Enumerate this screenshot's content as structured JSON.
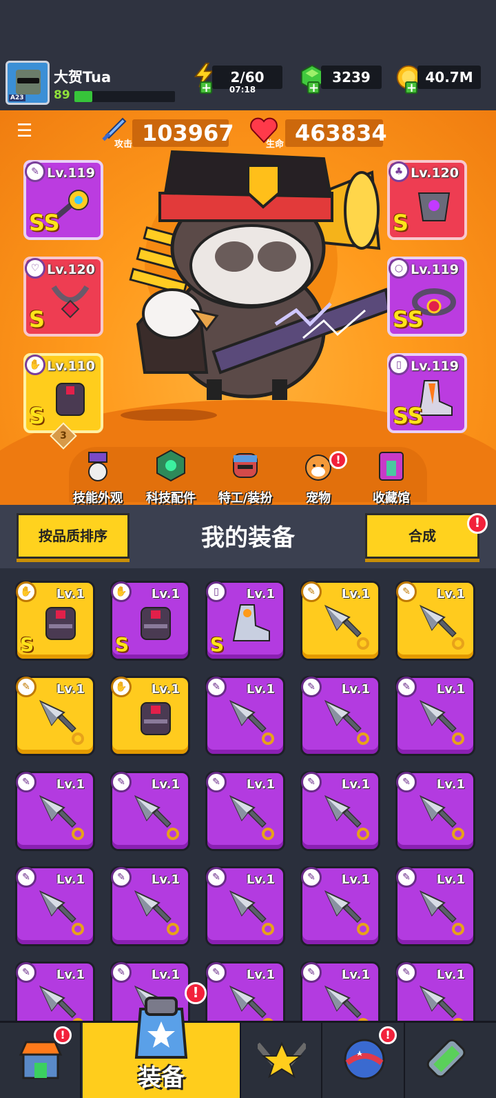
{
  "player": {
    "name": "大贺Tua",
    "level": "89",
    "xp_fraction": 0.18,
    "avatar_tag": "A23"
  },
  "resources": {
    "energy": {
      "value": "2/60",
      "timer": "07:18"
    },
    "gems": {
      "value": "3239"
    },
    "coins": {
      "value": "40.7M"
    }
  },
  "stats": {
    "attack": {
      "label": "攻击",
      "value": "103967"
    },
    "health": {
      "label": "生命",
      "value": "463834"
    }
  },
  "equipped": [
    {
      "slot": "weapon",
      "level": "Lv.119",
      "grade": "SS",
      "rarity": "purple"
    },
    {
      "slot": "necklace",
      "level": "Lv.120",
      "grade": "S",
      "rarity": "red"
    },
    {
      "slot": "gloves",
      "level": "Lv.110",
      "grade": "S",
      "rarity": "gold",
      "stars": "3"
    },
    {
      "slot": "armor",
      "level": "Lv.120",
      "grade": "S",
      "rarity": "red"
    },
    {
      "slot": "belt",
      "level": "Lv.119",
      "grade": "SS",
      "rarity": "purple"
    },
    {
      "slot": "boots",
      "level": "Lv.119",
      "grade": "SS",
      "rarity": "purple"
    }
  ],
  "features": [
    {
      "label": "技能外观",
      "icon": "skin-icon",
      "badge": false
    },
    {
      "label": "科技配件",
      "icon": "tech-icon",
      "badge": false
    },
    {
      "label": "特工/装扮",
      "icon": "agent-icon",
      "badge": false
    },
    {
      "label": "宠物",
      "icon": "pet-icon",
      "badge": true
    },
    {
      "label": "收藏馆",
      "icon": "collection-icon",
      "badge": false
    }
  ],
  "equipment_section": {
    "title": "我的装备",
    "sort_button": "按品质排序",
    "merge_button": "合成",
    "merge_badge": "!"
  },
  "inventory": [
    {
      "level": "Lv.1",
      "rarity": "gold",
      "kind": "gloves",
      "grade": "S"
    },
    {
      "level": "Lv.1",
      "rarity": "purple",
      "kind": "gloves",
      "grade": "S"
    },
    {
      "level": "Lv.1",
      "rarity": "purple",
      "kind": "boots",
      "grade": "S"
    },
    {
      "level": "Lv.1",
      "rarity": "gold",
      "kind": "kunai",
      "grade": ""
    },
    {
      "level": "Lv.1",
      "rarity": "gold",
      "kind": "kunai",
      "grade": ""
    },
    {
      "level": "Lv.1",
      "rarity": "gold",
      "kind": "kunai",
      "grade": ""
    },
    {
      "level": "Lv.1",
      "rarity": "gold",
      "kind": "gloves",
      "grade": ""
    },
    {
      "level": "Lv.1",
      "rarity": "purple",
      "kind": "kunai",
      "grade": ""
    },
    {
      "level": "Lv.1",
      "rarity": "purple",
      "kind": "kunai",
      "grade": ""
    },
    {
      "level": "Lv.1",
      "rarity": "purple",
      "kind": "kunai",
      "grade": ""
    },
    {
      "level": "Lv.1",
      "rarity": "purple",
      "kind": "kunai",
      "grade": ""
    },
    {
      "level": "Lv.1",
      "rarity": "purple",
      "kind": "kunai",
      "grade": ""
    },
    {
      "level": "Lv.1",
      "rarity": "purple",
      "kind": "kunai",
      "grade": ""
    },
    {
      "level": "Lv.1",
      "rarity": "purple",
      "kind": "kunai",
      "grade": ""
    },
    {
      "level": "Lv.1",
      "rarity": "purple",
      "kind": "kunai",
      "grade": ""
    },
    {
      "level": "Lv.1",
      "rarity": "purple",
      "kind": "kunai",
      "grade": ""
    },
    {
      "level": "Lv.1",
      "rarity": "purple",
      "kind": "kunai",
      "grade": ""
    },
    {
      "level": "Lv.1",
      "rarity": "purple",
      "kind": "kunai",
      "grade": ""
    },
    {
      "level": "Lv.1",
      "rarity": "purple",
      "kind": "kunai",
      "grade": ""
    },
    {
      "level": "Lv.1",
      "rarity": "purple",
      "kind": "kunai",
      "grade": ""
    },
    {
      "level": "Lv.1",
      "rarity": "purple",
      "kind": "kunai",
      "grade": ""
    },
    {
      "level": "Lv.1",
      "rarity": "purple",
      "kind": "kunai",
      "grade": ""
    },
    {
      "level": "Lv.1",
      "rarity": "purple",
      "kind": "kunai",
      "grade": ""
    },
    {
      "level": "Lv.1",
      "rarity": "purple",
      "kind": "kunai",
      "grade": ""
    },
    {
      "level": "Lv.1",
      "rarity": "purple",
      "kind": "kunai",
      "grade": ""
    }
  ],
  "nav": [
    {
      "label": "",
      "icon": "shop-icon",
      "badge": true,
      "active": false
    },
    {
      "label": "装备",
      "icon": "equipment-icon",
      "badge": true,
      "active": true
    },
    {
      "label": "",
      "icon": "battle-icon",
      "badge": false,
      "active": false
    },
    {
      "label": "",
      "icon": "ball-icon",
      "badge": true,
      "active": false
    },
    {
      "label": "",
      "icon": "gene-icon",
      "badge": false,
      "active": false
    }
  ],
  "colors": {
    "stage_orange": "#ff9a1c",
    "gold": "#ffcd1c",
    "purple": "#b33be0",
    "red": "#ee3d52",
    "badge_red": "#f2213b",
    "green": "#37c43a"
  }
}
